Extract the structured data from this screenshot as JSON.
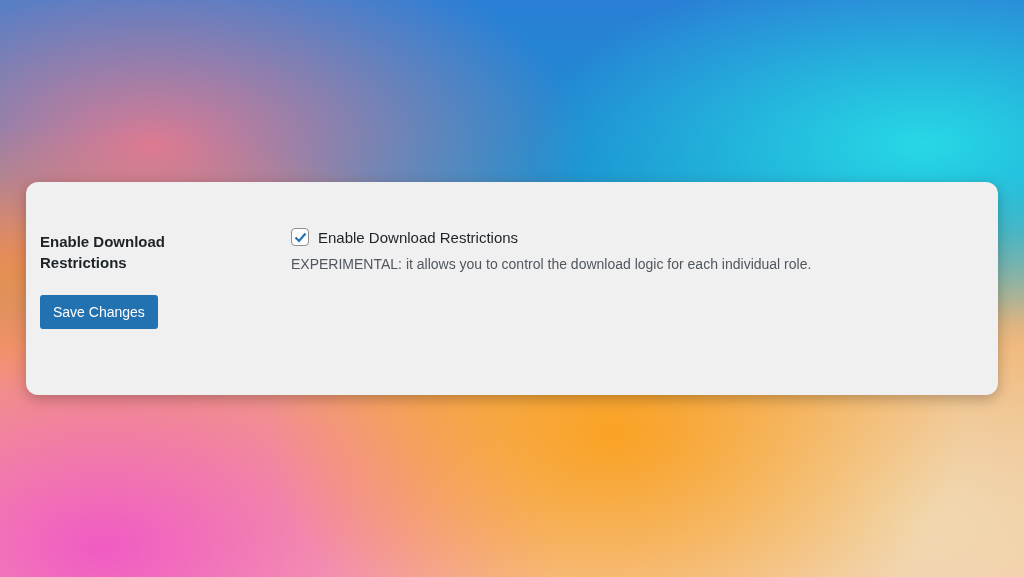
{
  "settings": {
    "rows": [
      {
        "label": "Enable Download Restrictions",
        "checkbox": {
          "label": "Enable Download Restrictions",
          "checked": true
        },
        "description": "EXPERIMENTAL: it allows you to control the download logic for each individual role."
      }
    ]
  },
  "save_button": {
    "label": "Save Changes"
  }
}
